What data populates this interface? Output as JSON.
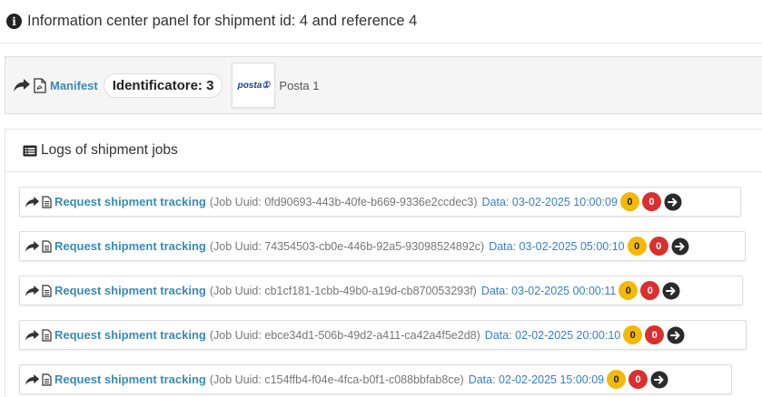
{
  "header": {
    "title": "Information center panel for shipment id: 4 and reference 4"
  },
  "manifest": {
    "link_label": "Manifest",
    "identifier": "Identificatore: 3",
    "carrier_logo_text": "posta①",
    "carrier_name": "Posta 1"
  },
  "logs": {
    "title": "Logs of shipment jobs",
    "jobs": [
      {
        "label": "Request shipment tracking",
        "uuid": "(Job Uuid: 0fd90693-443b-40fe-b669-9336e2ccdec3)",
        "date": "Data: 03-02-2025 10:00:09",
        "warn": "0",
        "err": "0"
      },
      {
        "label": "Request shipment tracking",
        "uuid": "(Job Uuid: 74354503-cb0e-446b-92a5-93098524892c)",
        "date": "Data: 03-02-2025 05:00:10",
        "warn": "0",
        "err": "0"
      },
      {
        "label": "Request shipment tracking",
        "uuid": "(Job Uuid: cb1cf181-1cbb-49b0-a19d-cb870053293f)",
        "date": "Data: 03-02-2025 00:00:11",
        "warn": "0",
        "err": "0"
      },
      {
        "label": "Request shipment tracking",
        "uuid": "(Job Uuid: ebce34d1-506b-49d2-a411-ca42a4f5e2d8)",
        "date": "Data: 02-02-2025 20:00:10",
        "warn": "0",
        "err": "0"
      },
      {
        "label": "Request shipment tracking",
        "uuid": "(Job Uuid: c154ffb4-f04e-4fca-b0f1-c088bbfab8ce)",
        "date": "Data: 02-02-2025 15:00:09",
        "warn": "0",
        "err": "0"
      }
    ]
  },
  "colors": {
    "link": "#3a8bb3",
    "date": "#3a7fc4",
    "badge_warning": "#f3b909",
    "badge_error": "#d9302f"
  },
  "icons": {
    "header": "info-circle-icon",
    "manifest": [
      "share-arrow-icon",
      "pdf-file-icon"
    ],
    "logs_title": "list-icon",
    "job": [
      "share-arrow-icon",
      "document-icon",
      "arrow-circle-right-icon"
    ]
  }
}
